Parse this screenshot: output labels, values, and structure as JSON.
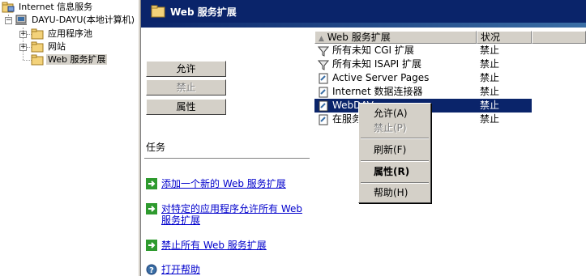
{
  "tree": {
    "root_label": "Internet 信息服务",
    "server_label": "DAYU-DAYU(本地计算机)",
    "items": [
      {
        "label": "应用程序池"
      },
      {
        "label": "网站"
      },
      {
        "label": "Web 服务扩展"
      }
    ]
  },
  "header": {
    "title": "Web 服务扩展"
  },
  "buttons": {
    "allow": "允许",
    "prohibit": "禁止",
    "properties": "属性"
  },
  "tasks": {
    "title": "任务",
    "items": [
      {
        "text": "添加一个新的 Web 服务扩展"
      },
      {
        "text": "对特定的应用程序允许所有 Web 服务扩展"
      },
      {
        "text": "禁止所有 Web 服务扩展"
      },
      {
        "text": "打开帮助"
      }
    ]
  },
  "list": {
    "columns": [
      "Web 服务扩展",
      "状况"
    ],
    "rows": [
      {
        "name": "所有未知 CGI 扩展",
        "status": "禁止",
        "icon": "filter-icon"
      },
      {
        "name": "所有未知 ISAPI 扩展",
        "status": "禁止",
        "icon": "filter-icon"
      },
      {
        "name": "Active Server Pages",
        "status": "禁止",
        "icon": "extension-icon"
      },
      {
        "name": "Internet 数据连接器",
        "status": "禁止",
        "icon": "extension-icon"
      },
      {
        "name": "WebDAV",
        "status": "禁止",
        "icon": "extension-icon"
      },
      {
        "name": "在服务器端的包含文件",
        "status": "禁止",
        "icon": "extension-icon"
      }
    ]
  },
  "context_menu": {
    "items": [
      {
        "label": "允许(A)"
      },
      {
        "label": "禁止(P)"
      },
      {
        "label": "刷新(F)"
      },
      {
        "label": "属性(R)"
      },
      {
        "label": "帮助(H)"
      }
    ]
  }
}
